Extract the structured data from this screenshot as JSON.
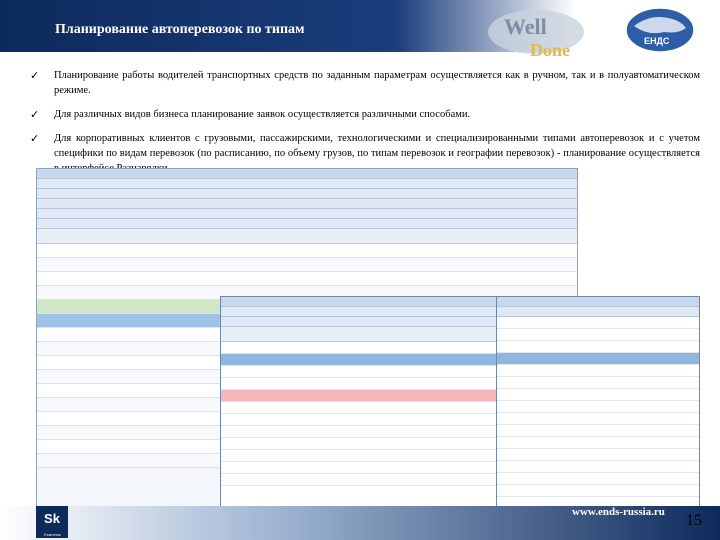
{
  "slide": {
    "title": "Планирование автоперевозок по типам",
    "page_number": "15",
    "url": "www.ends-russia.ru"
  },
  "logos": {
    "well": "Well",
    "done": "Done",
    "ends": "ЕНДС",
    "sk": "Sk",
    "sk_sub": "Участник"
  },
  "bullets": [
    "Планирование работы водителей транспортных средств по заданным параметрам осуществляется как в ручном, так и в полуавтоматическом режиме.",
    "Для различных видов бизнеса планирование заявок осуществляется различными способами.",
    "Для корпоративных клиентов с грузовыми, пассажирскими, технологическими и специализированными типами автоперевозок и с учетом специфики по видам перевозок (по расписанию, по объему грузов, по типам перевозок и географии перевозок) - планирование осуществляется в интерфейсе Разнарядки."
  ],
  "bullet_icon": "check-icon",
  "colors": {
    "header_dark": "#0d2a5c",
    "selection": "#9fc3e6",
    "alert_row": "#f5b7b7"
  }
}
